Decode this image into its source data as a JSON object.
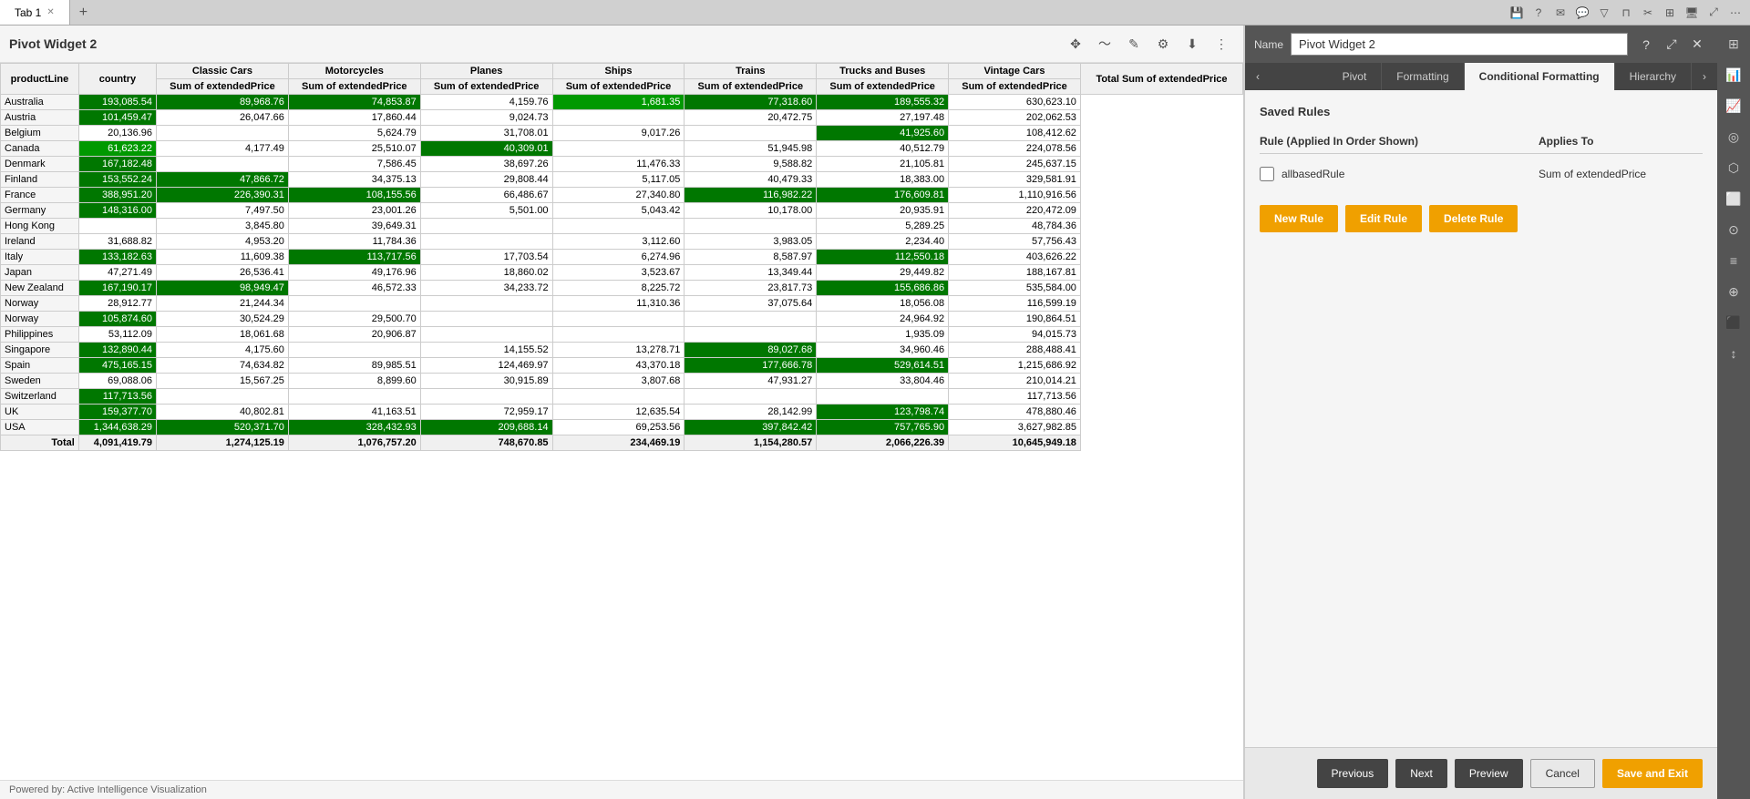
{
  "tabBar": {
    "tab1Label": "Tab 1",
    "addTabLabel": "+"
  },
  "pivotWidget": {
    "title": "Pivot Widget 2",
    "toolbar": {
      "moveIcon": "✥",
      "editIcon": "✎",
      "pencilIcon": "✏",
      "settingsIcon": "⚙",
      "downloadIcon": "⬇",
      "menuIcon": "⋮"
    },
    "columns": {
      "rowHeader1": "productLine",
      "rowHeader2": "country",
      "cols": [
        "Classic Cars",
        "Motorcycles",
        "Planes",
        "Ships",
        "Trains",
        "Trucks and Buses",
        "Vintage Cars"
      ],
      "totalCol": "Total Sum of extendedPrice",
      "subHeader": "Sum of extendedPrice"
    },
    "rows": [
      {
        "country": "Australia",
        "classicCars": "193,085.54",
        "motorcycles": "89,968.76",
        "planes": "74,853.87",
        "ships": "4,159.76",
        "trains": "1,681.35",
        "trucksAndBuses": "77,318.60",
        "vintageCars": "189,555.32",
        "total": "630,623.10",
        "classicCarsGreen": "dark",
        "motorcyclesGreen": "dark",
        "planesGreen": "dark",
        "trainsGreen": "medium",
        "trucksAndBusesGreen": "dark",
        "vintageCarsGreen": "dark"
      },
      {
        "country": "Austria",
        "classicCars": "101,459.47",
        "motorcycles": "26,047.66",
        "planes": "17,860.44",
        "ships": "9,024.73",
        "trains": "",
        "trucksAndBuses": "20,472.75",
        "vintageCars": "27,197.48",
        "total": "202,062.53",
        "classicCarsGreen": "dark"
      },
      {
        "country": "Belgium",
        "classicCars": "20,136.96",
        "motorcycles": "",
        "planes": "5,624.79",
        "ships": "31,708.01",
        "trains": "9,017.26",
        "trucksAndBuses": "",
        "vintageCars": "41,925.60",
        "total": "108,412.62",
        "vintageCarsGreen": "dark"
      },
      {
        "country": "Canada",
        "classicCars": "61,623.22",
        "motorcycles": "4,177.49",
        "planes": "25,510.07",
        "ships": "40,309.01",
        "trains": "",
        "trucksAndBuses": "51,945.98",
        "vintageCars": "40,512.79",
        "total": "224,078.56",
        "classicCarsGreen": "medium",
        "shipsGreen": "dark"
      },
      {
        "country": "Denmark",
        "classicCars": "167,182.48",
        "motorcycles": "",
        "planes": "7,586.45",
        "ships": "38,697.26",
        "trains": "11,476.33",
        "trucksAndBuses": "9,588.82",
        "vintageCars": "21,105.81",
        "total": "245,637.15",
        "classicCarsGreen": "dark"
      },
      {
        "country": "Finland",
        "classicCars": "153,552.24",
        "motorcycles": "47,866.72",
        "planes": "34,375.13",
        "ships": "29,808.44",
        "trains": "5,117.05",
        "trucksAndBuses": "40,479.33",
        "vintageCars": "18,383.00",
        "total": "329,581.91",
        "classicCarsGreen": "dark",
        "motorcyclesGreen": "dark"
      },
      {
        "country": "France",
        "classicCars": "388,951.20",
        "motorcycles": "226,390.31",
        "planes": "108,155.56",
        "ships": "66,486.67",
        "trains": "27,340.80",
        "trucksAndBuses": "116,982.22",
        "vintageCars": "176,609.81",
        "total": "1,110,916.56",
        "classicCarsGreen": "dark",
        "motorcyclesGreen": "dark",
        "planesGreen": "dark",
        "trucksAndBusesGreen": "dark",
        "vintageCarsGreen": "dark"
      },
      {
        "country": "Germany",
        "classicCars": "148,316.00",
        "motorcycles": "7,497.50",
        "planes": "23,001.26",
        "ships": "5,501.00",
        "trains": "5,043.42",
        "trucksAndBuses": "10,178.00",
        "vintageCars": "20,935.91",
        "total": "220,472.09",
        "classicCarsGreen": "dark"
      },
      {
        "country": "Hong Kong",
        "classicCars": "",
        "motorcycles": "3,845.80",
        "planes": "39,649.31",
        "ships": "",
        "trains": "",
        "trucksAndBuses": "",
        "vintageCars": "5,289.25",
        "total": "48,784.36"
      },
      {
        "country": "Ireland",
        "classicCars": "31,688.82",
        "motorcycles": "4,953.20",
        "planes": "11,784.36",
        "ships": "",
        "trains": "3,112.60",
        "trucksAndBuses": "3,983.05",
        "vintageCars": "2,234.40",
        "total": "57,756.43"
      },
      {
        "country": "Italy",
        "classicCars": "133,182.63",
        "motorcycles": "11,609.38",
        "planes": "113,717.56",
        "ships": "17,703.54",
        "trains": "6,274.96",
        "trucksAndBuses": "8,587.97",
        "vintageCars": "112,550.18",
        "total": "403,626.22",
        "classicCarsGreen": "dark",
        "planesGreen": "dark",
        "vintageCarsGreen": "dark"
      },
      {
        "country": "Japan",
        "classicCars": "47,271.49",
        "motorcycles": "26,536.41",
        "planes": "49,176.96",
        "ships": "18,860.02",
        "trains": "3,523.67",
        "trucksAndBuses": "13,349.44",
        "vintageCars": "29,449.82",
        "total": "188,167.81"
      },
      {
        "country": "New Zealand",
        "classicCars": "167,190.17",
        "motorcycles": "98,949.47",
        "planes": "46,572.33",
        "ships": "34,233.72",
        "trains": "8,225.72",
        "trucksAndBuses": "23,817.73",
        "vintageCars": "155,686.86",
        "total": "535,584.00",
        "classicCarsGreen": "dark",
        "motorcyclesGreen": "dark",
        "vintageCarsGreen": "dark"
      },
      {
        "country": "Norway",
        "classicCars": "28,912.77",
        "motorcycles": "21,244.34",
        "planes": "",
        "ships": "",
        "trains": "11,310.36",
        "trucksAndBuses": "37,075.64",
        "vintageCars": "18,056.08",
        "total": "116,599.19"
      },
      {
        "country": "Norway",
        "classicCars": "105,874.60",
        "motorcycles": "30,524.29",
        "planes": "29,500.70",
        "ships": "",
        "trains": "",
        "trucksAndBuses": "",
        "vintageCars": "24,964.92",
        "total": "190,864.51",
        "classicCarsGreen": "dark"
      },
      {
        "country": "Philippines",
        "classicCars": "53,112.09",
        "motorcycles": "18,061.68",
        "planes": "20,906.87",
        "ships": "",
        "trains": "",
        "trucksAndBuses": "",
        "vintageCars": "1,935.09",
        "total": "94,015.73"
      },
      {
        "country": "Singapore",
        "classicCars": "132,890.44",
        "motorcycles": "4,175.60",
        "planes": "",
        "ships": "14,155.52",
        "trains": "13,278.71",
        "trucksAndBuses": "89,027.68",
        "vintageCars": "34,960.46",
        "total": "288,488.41",
        "classicCarsGreen": "dark",
        "trucksAndBusesGreen": "dark"
      },
      {
        "country": "Spain",
        "classicCars": "475,165.15",
        "motorcycles": "74,634.82",
        "planes": "89,985.51",
        "ships": "124,469.97",
        "trains": "43,370.18",
        "trucksAndBuses": "177,666.78",
        "vintageCars": "529,614.51",
        "total": "1,215,686.92",
        "classicCarsGreen": "dark",
        "trucksAndBusesGreen": "dark",
        "vintageCarsGreen": "dark"
      },
      {
        "country": "Sweden",
        "classicCars": "69,088.06",
        "motorcycles": "15,567.25",
        "planes": "8,899.60",
        "ships": "30,915.89",
        "trains": "3,807.68",
        "trucksAndBuses": "47,931.27",
        "vintageCars": "33,804.46",
        "total": "210,014.21"
      },
      {
        "country": "Switzerland",
        "classicCars": "117,713.56",
        "motorcycles": "",
        "planes": "",
        "ships": "",
        "trains": "",
        "trucksAndBuses": "",
        "vintageCars": "",
        "total": "117,713.56",
        "classicCarsGreen": "dark"
      },
      {
        "country": "UK",
        "classicCars": "159,377.70",
        "motorcycles": "40,802.81",
        "planes": "41,163.51",
        "ships": "72,959.17",
        "trains": "12,635.54",
        "trucksAndBuses": "28,142.99",
        "vintageCars": "123,798.74",
        "total": "478,880.46",
        "classicCarsGreen": "dark",
        "vintageCarsGreen": "dark"
      },
      {
        "country": "USA",
        "classicCars": "1,344,638.29",
        "motorcycles": "520,371.70",
        "planes": "328,432.93",
        "ships": "209,688.14",
        "trains": "69,253.56",
        "trucksAndBuses": "397,842.42",
        "vintageCars": "757,765.90",
        "total": "3,627,982.85",
        "classicCarsGreen": "dark",
        "motorcyclesGreen": "dark",
        "planesGreen": "dark",
        "shipsGreen": "dark",
        "trucksAndBusesGreen": "dark",
        "vintageCarsGreen": "dark"
      }
    ],
    "totals": {
      "label": "Total",
      "classicCars": "4,091,419.79",
      "motorcycles": "1,274,125.19",
      "planes": "1,076,757.20",
      "ships": "748,670.85",
      "trains": "234,469.19",
      "trucksAndBuses": "1,154,280.57",
      "vintageCars": "2,066,226.39",
      "total": "10,645,949.18"
    },
    "footer": "Powered by: Active Intelligence Visualization"
  },
  "rightPanel": {
    "nameLabel": "Name",
    "nameValue": "Pivot Widget 2",
    "tabs": [
      "Pivot",
      "Formatting",
      "Conditional Formatting",
      "Hierarchy"
    ],
    "activeTab": "Conditional Formatting",
    "savedRulesLabel": "Saved Rules",
    "rulesTableHeader": {
      "col1": "Rule (Applied In Order Shown)",
      "col2": "Applies To"
    },
    "rules": [
      {
        "name": "allbasedRule",
        "appliesTo": "Sum of extendedPrice",
        "checked": false
      }
    ],
    "buttons": {
      "newRule": "New Rule",
      "editRule": "Edit Rule",
      "deleteRule": "Delete Rule"
    },
    "bottomButtons": {
      "previous": "Previous",
      "next": "Next",
      "preview": "Preview",
      "cancel": "Cancel",
      "saveAndExit": "Save and Exit"
    }
  },
  "sideIcons": [
    "⊞",
    "📊",
    "📈",
    "◎",
    "⬡",
    "⬜",
    "⊙",
    "≡",
    "⊕",
    "⬛",
    "↕"
  ]
}
